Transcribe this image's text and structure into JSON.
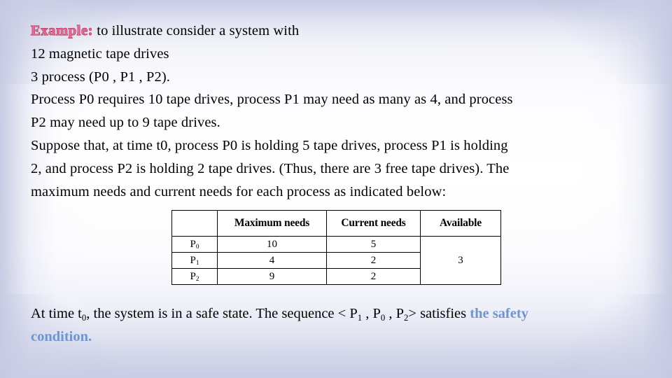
{
  "slide": {
    "background_frame_color": "#c7cbe4",
    "background_center_color": "#ffffff"
  },
  "body": {
    "example_label": "Example:",
    "line1_rest": " to illustrate consider a system with",
    "line2": "12 magnetic tape drives",
    "line3": "3 process (P0 , P1 , P2).",
    "line4": "Process P0 requires 10 tape drives, process P1 may need as many as 4, and process",
    "line5": "P2 may need up to 9 tape drives.",
    "line6": "Suppose that, at time t0, process P0 is holding 5 tape drives, process P1 is holding",
    "line7": "2, and process P2 is holding 2 tape drives. (Thus, there are 3 free tape drives). The",
    "line8": "maximum needs and current needs for each process as indicated below:",
    "example_color": "#e46a94",
    "example_outline_color": "#a21843"
  },
  "table": {
    "headers": [
      "",
      "Maximum needs",
      "Current needs",
      "Available"
    ],
    "rows": [
      {
        "process": "P",
        "process_sub": "0",
        "maximum_needs": "10",
        "current_needs": "5"
      },
      {
        "process": "P",
        "process_sub": "1",
        "maximum_needs": "4",
        "current_needs": "2"
      },
      {
        "process": "P",
        "process_sub": "2",
        "maximum_needs": "9",
        "current_needs": "2"
      }
    ],
    "available_value": "3"
  },
  "conclusion": {
    "prefix": "At time t",
    "prefix_sub": "0",
    "mid": ", the system is in a safe state. The sequence < P",
    "seq1_sub": "1",
    "seq_sep1": " , P",
    "seq2_sub": "0",
    "seq_sep2": " , P",
    "seq3_sub": "2",
    "seq_close": "> satisfies ",
    "highlight1": "the safety",
    "highlight2": "condition.",
    "highlight_color": "#6e95d0"
  }
}
